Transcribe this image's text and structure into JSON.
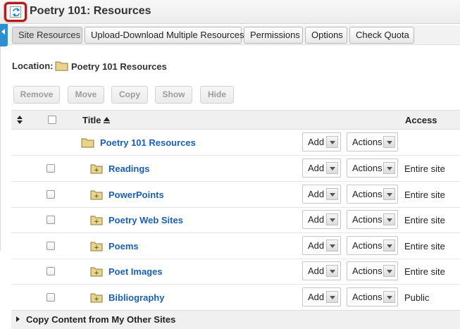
{
  "page": {
    "title": "Poetry 101: Resources",
    "reset_icon": "reset-arrows-icon"
  },
  "toolbar": {
    "tabs": [
      {
        "label": "Site Resources",
        "active": true
      },
      {
        "label": "Upload-Download Multiple Resources",
        "active": false
      },
      {
        "label": "Permissions",
        "active": false
      },
      {
        "label": "Options",
        "active": false
      },
      {
        "label": "Check Quota",
        "active": false
      }
    ]
  },
  "location": {
    "label": "Location:",
    "value": "Poetry 101 Resources"
  },
  "actions": {
    "buttons": [
      "Remove",
      "Move",
      "Copy",
      "Show",
      "Hide"
    ],
    "disabled": true
  },
  "table": {
    "headers": {
      "title": "Title",
      "access": "Access"
    },
    "root": {
      "name": "Poetry 101 Resources",
      "add": "Add",
      "actions": "Actions"
    },
    "rows": [
      {
        "name": "Readings",
        "add": "Add",
        "actions": "Actions",
        "access": "Entire site"
      },
      {
        "name": "PowerPoints",
        "add": "Add",
        "actions": "Actions",
        "access": "Entire site"
      },
      {
        "name": "Poetry Web Sites",
        "add": "Add",
        "actions": "Actions",
        "access": "Entire site"
      },
      {
        "name": "Poems",
        "add": "Add",
        "actions": "Actions",
        "access": "Entire site"
      },
      {
        "name": "Poet Images",
        "add": "Add",
        "actions": "Actions",
        "access": "Entire site"
      },
      {
        "name": "Bibliography",
        "add": "Add",
        "actions": "Actions",
        "access": "Public"
      }
    ]
  },
  "footer": {
    "label": "Copy Content from My Other Sites"
  },
  "colors": {
    "link": "#1a5fb4",
    "highlight": "#b01e1e",
    "accent_strip": "#2c8fd0",
    "folder": "#e8d48a"
  }
}
